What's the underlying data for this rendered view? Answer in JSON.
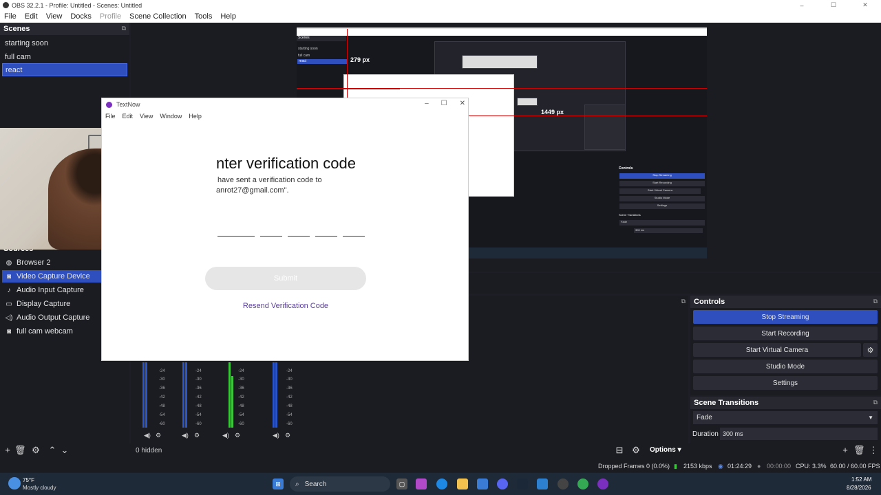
{
  "window": {
    "title": "OBS 32.2.1 - Profile: Untitled - Scenes: Untitled",
    "controls": [
      "–",
      "☐",
      "✕"
    ]
  },
  "menu": [
    "File",
    "Edit",
    "View",
    "Docks",
    "Profile",
    "Scene Collection",
    "Tools",
    "Help"
  ],
  "scenes": {
    "header": "Scenes",
    "items": [
      {
        "label": "starting soon",
        "selected": false
      },
      {
        "label": "full cam",
        "selected": false
      },
      {
        "label": "react",
        "selected": true
      }
    ]
  },
  "sources": {
    "header": "Sources",
    "items": [
      {
        "label": "Browser 2",
        "icon": "globe-icon",
        "selected": false
      },
      {
        "label": "Video Capture Device",
        "icon": "camera-icon",
        "selected": true
      },
      {
        "label": "Audio Input Capture",
        "icon": "microphone-icon",
        "selected": false
      },
      {
        "label": "Display Capture",
        "icon": "monitor-icon",
        "selected": false
      },
      {
        "label": "Audio Output Capture",
        "icon": "speaker-icon",
        "selected": false
      },
      {
        "label": "full cam webcam",
        "icon": "camera-icon",
        "selected": false
      }
    ]
  },
  "preview": {
    "label_279": "279 px",
    "label_1449": "1449 px",
    "nested_scenes": [
      "starting soon",
      "full cam",
      "react"
    ],
    "nested_controls": [
      "Stop Streaming",
      "Start Recording",
      "Start Virtual Camera",
      "Studio Mode",
      "Settings"
    ],
    "nested_transitions_header": "Scene Transitions",
    "nested_transition": "Fade",
    "nested_duration": "300 ms",
    "nested_controls_header": "Controls"
  },
  "textnow": {
    "title": "TextNow",
    "menu": [
      "File",
      "Edit",
      "View",
      "Window",
      "Help"
    ],
    "heading": "nter verification code",
    "sent_text": "have sent a verification code to",
    "email": "anrot27@gmail.com\".",
    "submit": "Submit",
    "resend": "Resend Verification Code"
  },
  "mixer": {
    "db_marks": [
      "-24",
      "-30",
      "-36",
      "-42",
      "-48",
      "-54",
      "-60"
    ],
    "hidden": "0 hidden"
  },
  "controls": {
    "header": "Controls",
    "buttons": [
      "Stop Streaming",
      "Start Recording",
      "Start Virtual Camera",
      "Studio Mode",
      "Settings"
    ]
  },
  "transitions": {
    "header": "Scene Transitions",
    "selected": "Fade",
    "duration_label": "Duration",
    "duration_value": "300 ms"
  },
  "options_label": "Options",
  "status": {
    "dropped": "Dropped Frames 0 (0.0%)",
    "bitrate": "2153 kbps",
    "stream_time": "01:24:29",
    "rec_time": "00:00:00",
    "cpu": "CPU: 3.3%",
    "fps": "60.00 / 60.00 FPS"
  },
  "taskbar": {
    "weather_temp": "75°F",
    "weather_desc": "Mostly cloudy",
    "search": "Search",
    "time": "1:52 AM",
    "date": "8/28/2026"
  },
  "colors": {
    "accent": "#2f4fbf",
    "panel": "#1b1c22",
    "textnow_purple": "#5a3f9e"
  }
}
